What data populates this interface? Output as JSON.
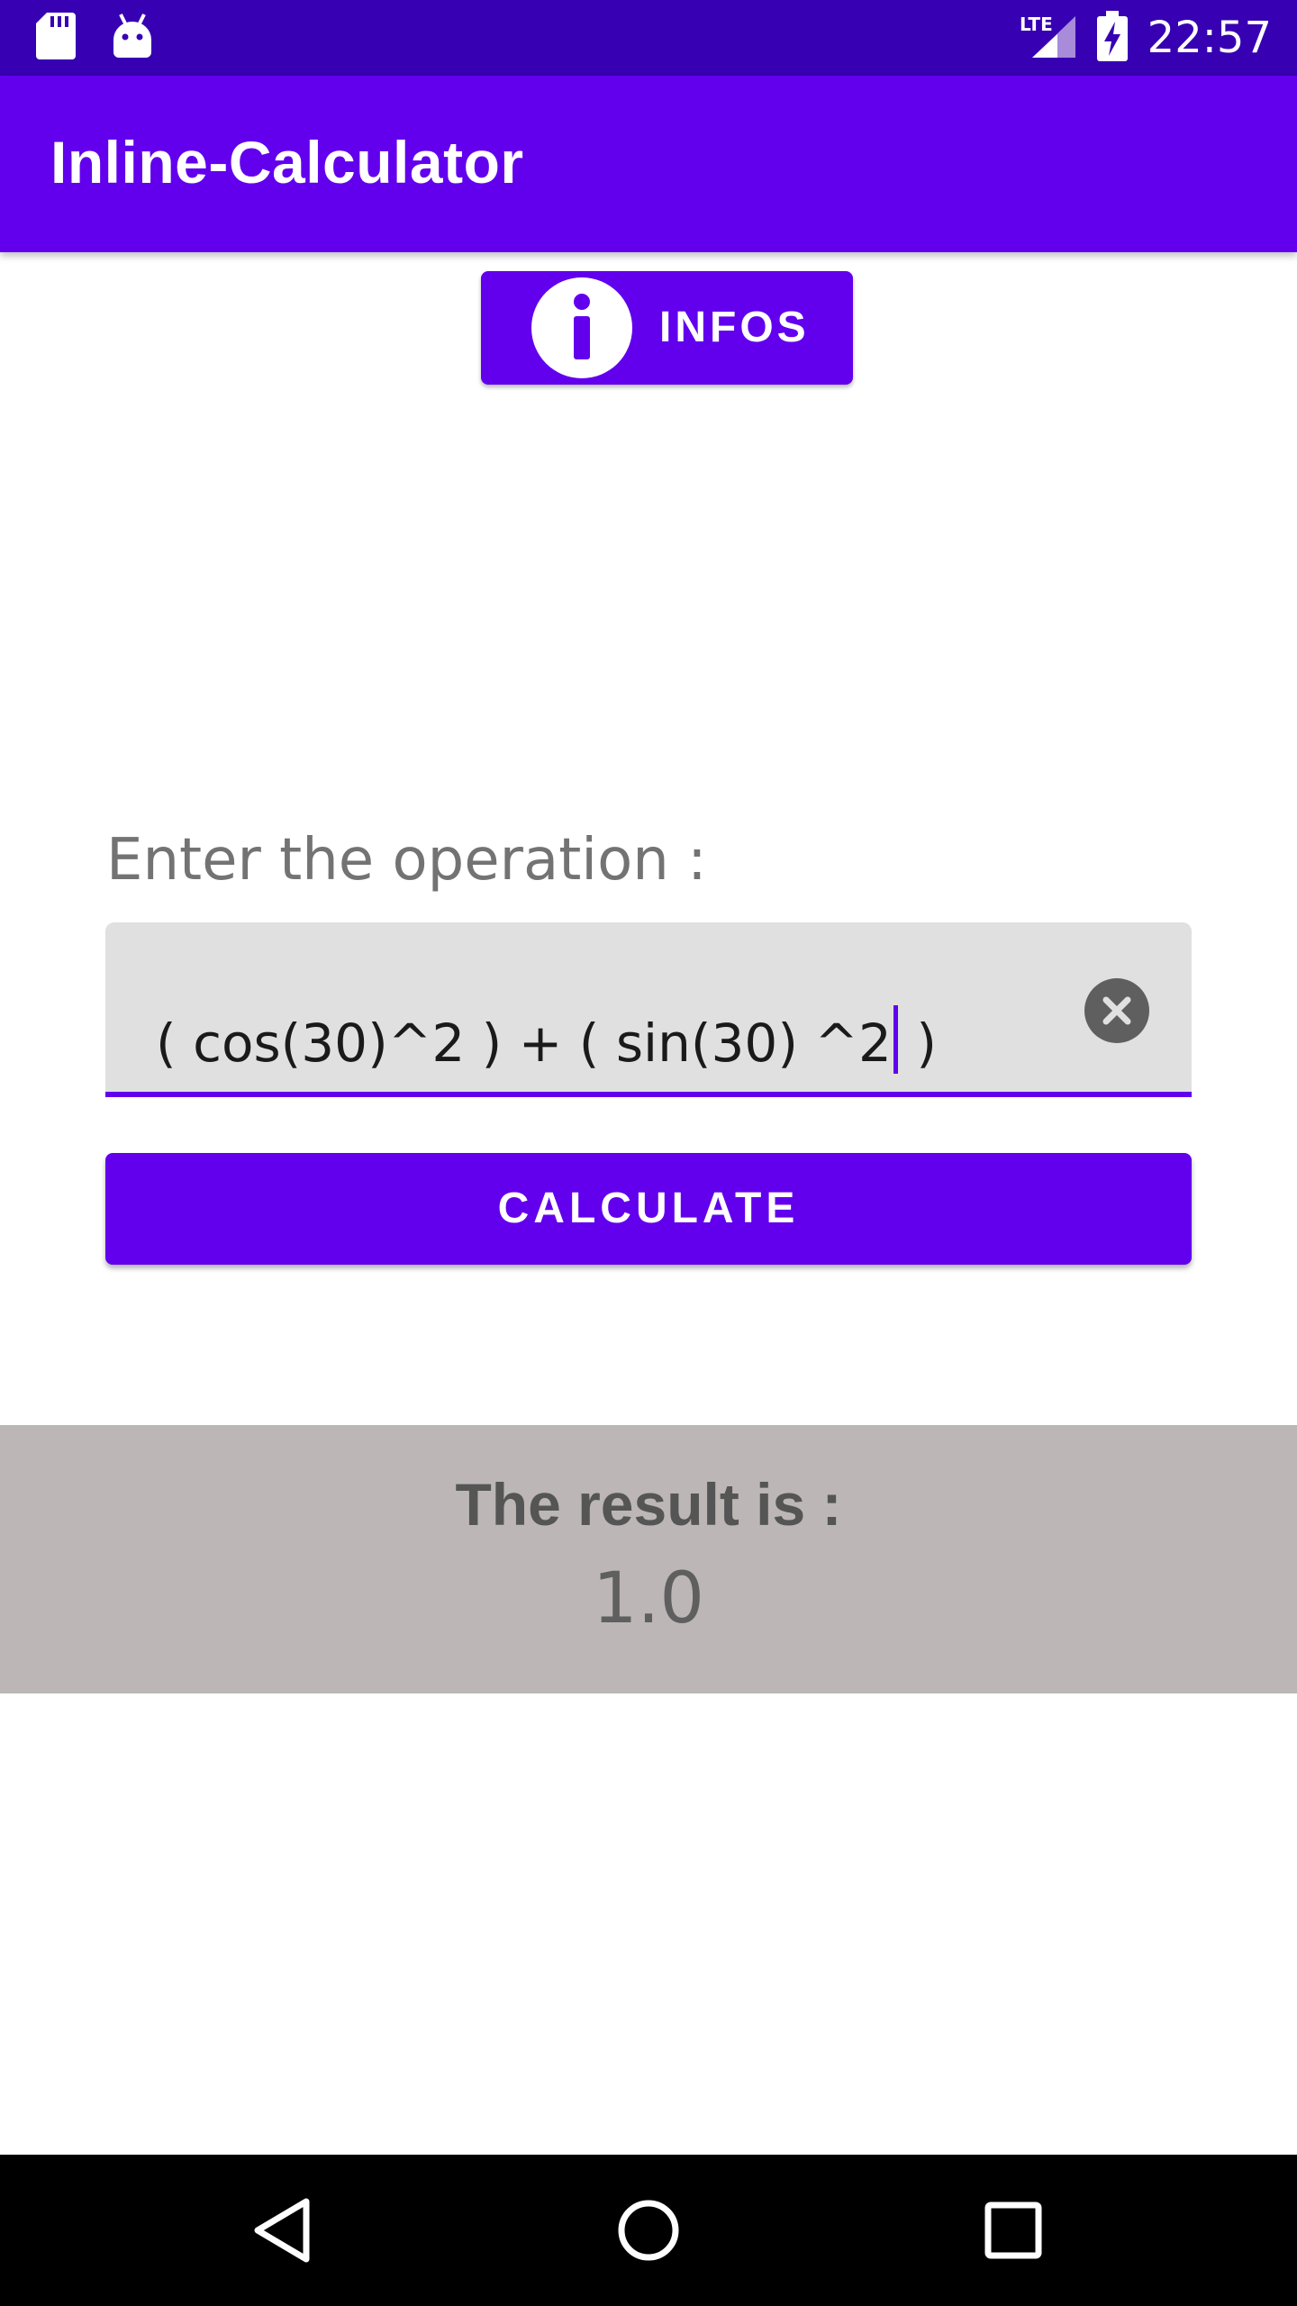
{
  "status_bar": {
    "time": "22:57",
    "network": "LTE",
    "icons": [
      "sd-card-icon",
      "android-icon",
      "lte-signal-icon",
      "battery-charging-icon"
    ]
  },
  "app_bar": {
    "title": "Inline-Calculator"
  },
  "infos_button": {
    "label": "INFOS",
    "icon": "info-icon"
  },
  "form": {
    "prompt": "Enter the operation :",
    "input_value_before_caret": "( cos(30)^2 ) + ( sin(30) ^2",
    "input_value_after_caret": " )",
    "clear_icon": "clear-icon",
    "calculate_label": "CALCULATE"
  },
  "result": {
    "heading": "The result is :",
    "value": "1.0"
  },
  "navigation": {
    "buttons": [
      "back-icon",
      "home-icon",
      "recents-icon"
    ]
  },
  "colors": {
    "status_bar": "#3700b3",
    "primary": "#6200ee",
    "result_background": "#bcb6b6",
    "input_background": "#e0e0e0"
  }
}
